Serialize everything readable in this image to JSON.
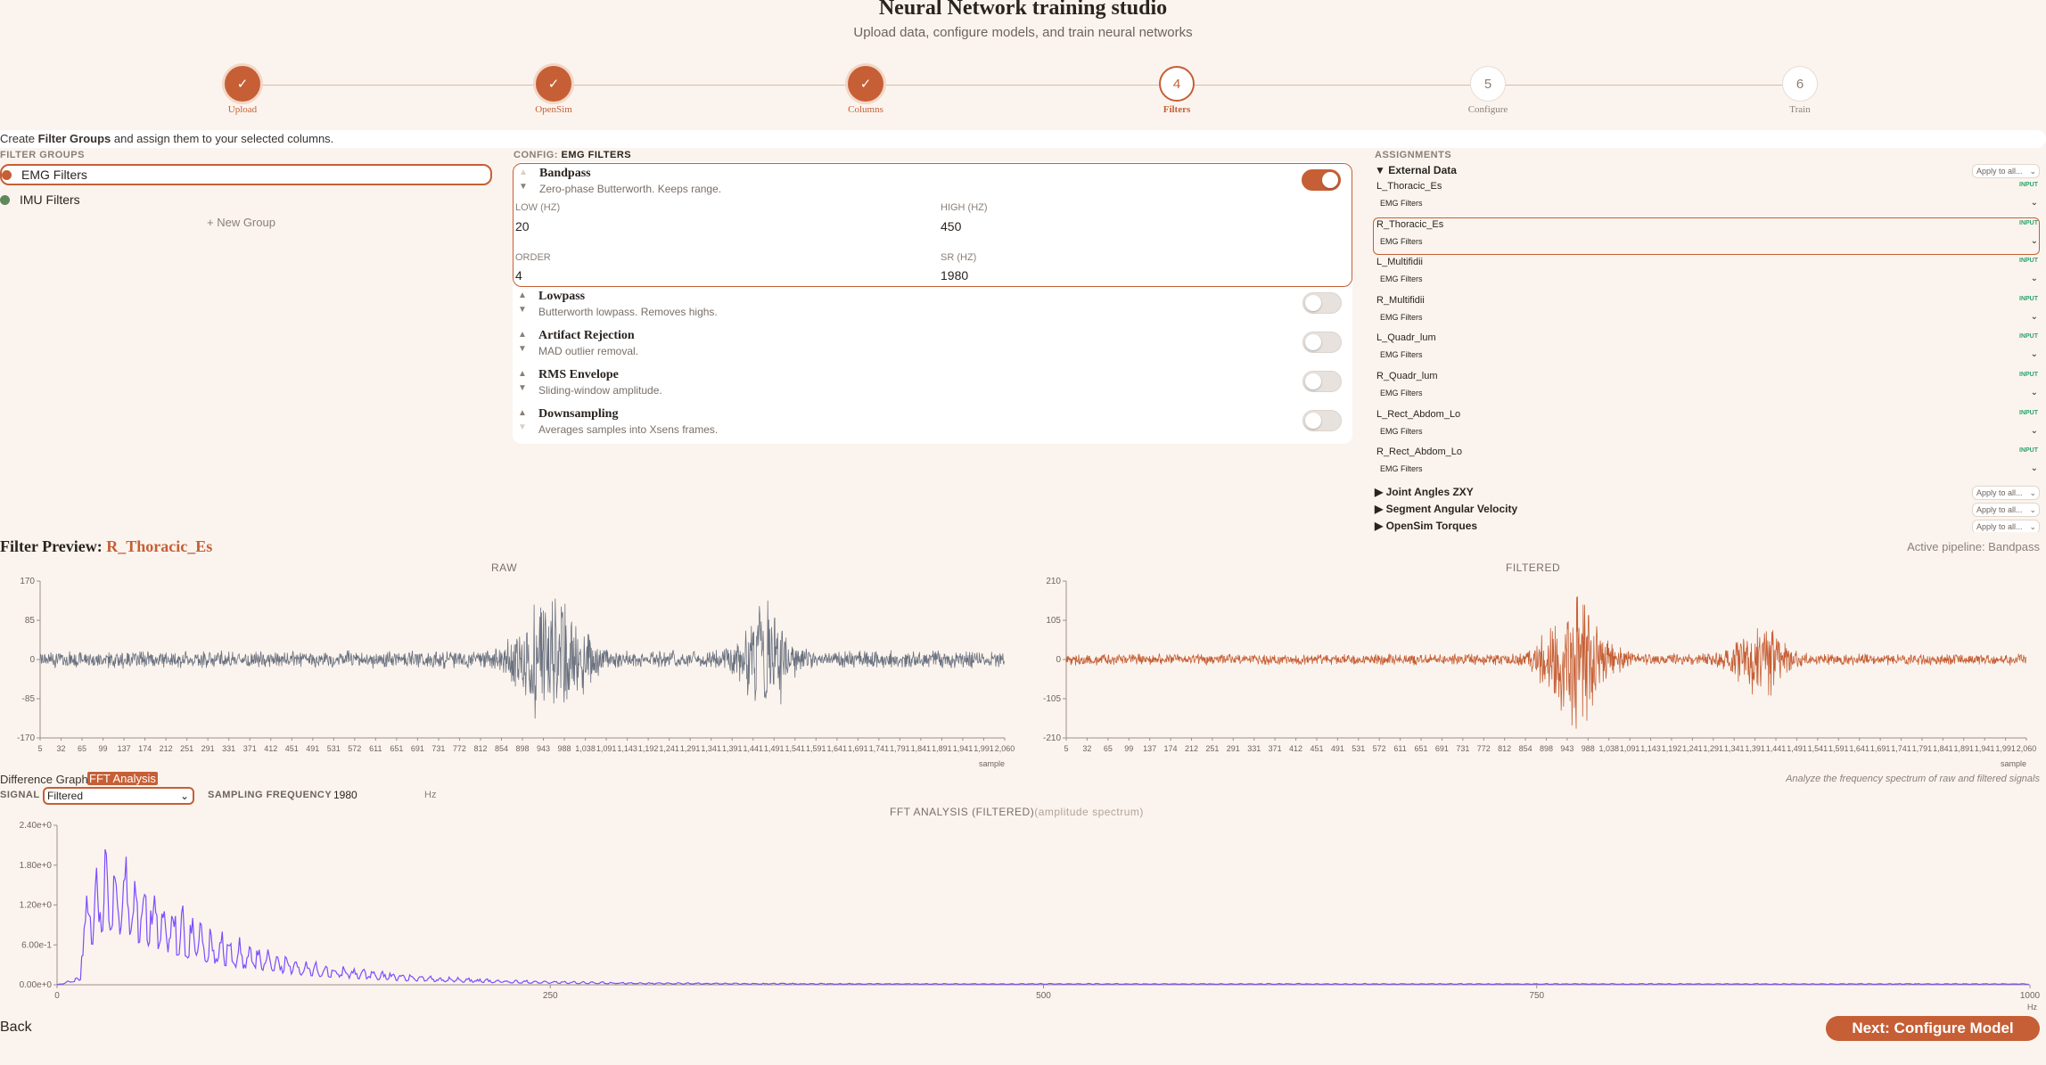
{
  "header": {
    "title": "Neural Network training studio",
    "subtitle": "Upload data, configure models, and train neural networks"
  },
  "stepper": [
    {
      "label": "Upload",
      "state": "done",
      "mark": "✓"
    },
    {
      "label": "OpenSim",
      "state": "done",
      "mark": "✓"
    },
    {
      "label": "Columns",
      "state": "done",
      "mark": "✓"
    },
    {
      "label": "Filters",
      "state": "active",
      "mark": "4"
    },
    {
      "label": "Configure",
      "state": "pending",
      "mark": "5"
    },
    {
      "label": "Train",
      "state": "pending",
      "mark": "6"
    }
  ],
  "instructions": {
    "pre": "Create ",
    "bold": "Filter Groups",
    "post": " and assign them to your selected columns."
  },
  "filter_groups": {
    "heading": "FILTER GROUPS",
    "items": [
      {
        "label": "EMG Filters",
        "color": "#c65f35",
        "selected": true
      },
      {
        "label": "IMU Filters",
        "color": "#5e8a5a",
        "selected": false
      }
    ],
    "new_group": "+ New Group"
  },
  "config": {
    "heading_prefix": "CONFIG: ",
    "heading_name": "EMG FILTERS",
    "filters": [
      {
        "name": "Bandpass",
        "desc": "Zero-phase Butterworth. Keeps range.",
        "enabled": true
      },
      {
        "name": "Lowpass",
        "desc": "Butterworth lowpass. Removes highs.",
        "enabled": false
      },
      {
        "name": "Artifact Rejection",
        "desc": "MAD outlier removal.",
        "enabled": false
      },
      {
        "name": "RMS Envelope",
        "desc": "Sliding-window amplitude.",
        "enabled": false
      },
      {
        "name": "Downsampling",
        "desc": "Averages samples into Xsens frames.",
        "enabled": false
      }
    ],
    "bandpass_params": {
      "low_label": "LOW (HZ)",
      "low_value": "20",
      "high_label": "HIGH (HZ)",
      "high_value": "450",
      "order_label": "ORDER",
      "order_value": "4",
      "sr_label": "SR (HZ)",
      "sr_value": "1980"
    }
  },
  "assignments": {
    "heading": "ASSIGNMENTS",
    "apply_label": "Apply to all...",
    "badge": "INPUT",
    "external_group": "External Data",
    "columns": [
      {
        "name": "L_Thoracic_Es",
        "filter": "EMG Filters"
      },
      {
        "name": "R_Thoracic_Es",
        "filter": "EMG Filters"
      },
      {
        "name": "L_Multifidii",
        "filter": "EMG Filters"
      },
      {
        "name": "R_Multifidii",
        "filter": "EMG Filters"
      },
      {
        "name": "L_Quadr_lum",
        "filter": "EMG Filters"
      },
      {
        "name": "R_Quadr_lum",
        "filter": "EMG Filters"
      },
      {
        "name": "L_Rect_Abdom_Lo",
        "filter": "EMG Filters"
      },
      {
        "name": "R_Rect_Abdom_Lo",
        "filter": "EMG Filters"
      }
    ],
    "collapsed_groups": [
      "Joint Angles ZXY",
      "Segment Angular Velocity",
      "OpenSim Torques"
    ]
  },
  "preview": {
    "title_prefix": "Filter Preview: ",
    "column": "R_Thoracic_Es",
    "active_pipeline": "Active pipeline: Bandpass"
  },
  "analysis": {
    "tab_diff": "Difference Graph",
    "tab_fft": "FFT Analysis",
    "note": "Analyze the frequency spectrum of raw and filtered signals",
    "signal_label": "SIGNAL",
    "signal_value": "Filtered",
    "sf_label": "SAMPLING FREQUENCY",
    "sf_value": "1980",
    "sf_unit": "Hz",
    "fft_title": "FFT ANALYSIS (FILTERED)",
    "fft_subtitle": "(amplitude spectrum)"
  },
  "footer": {
    "back": "Back",
    "next": "Next: Configure Model"
  },
  "chart_data": [
    {
      "type": "line",
      "title": "RAW",
      "xlabel": "sample",
      "color": "#6b7280",
      "ylim": [
        -170,
        170
      ],
      "yticks": [
        "170",
        "85",
        "0",
        "-85",
        "-170"
      ],
      "xticks": [
        "5",
        "32",
        "65",
        "99",
        "137",
        "174",
        "212",
        "251",
        "291",
        "331",
        "371",
        "412",
        "451",
        "491",
        "531",
        "572",
        "611",
        "651",
        "691",
        "731",
        "772",
        "812",
        "854",
        "898",
        "943",
        "988",
        "1,038",
        "1,091",
        "1,143",
        "1,192",
        "1,241",
        "1,291",
        "1,341",
        "1,391",
        "1,441",
        "1,491",
        "1,541",
        "1,591",
        "1,641",
        "1,691",
        "1,741",
        "1,791",
        "1,841",
        "1,891",
        "1,941",
        "1,991",
        "2,060"
      ],
      "baseline_amp": 15,
      "bursts": [
        {
          "center": 0.53,
          "width": 0.05,
          "amp": 160
        },
        {
          "center": 0.75,
          "width": 0.035,
          "amp": 140
        }
      ]
    },
    {
      "type": "line",
      "title": "FILTERED",
      "xlabel": "sample",
      "color": "#c65f35",
      "ylim": [
        -210,
        210
      ],
      "yticks": [
        "210",
        "105",
        "0",
        "-105",
        "-210"
      ],
      "xticks": [
        "5",
        "32",
        "65",
        "99",
        "137",
        "174",
        "212",
        "251",
        "291",
        "331",
        "371",
        "412",
        "451",
        "491",
        "531",
        "572",
        "611",
        "651",
        "691",
        "731",
        "772",
        "812",
        "854",
        "898",
        "943",
        "988",
        "1,038",
        "1,091",
        "1,143",
        "1,192",
        "1,241",
        "1,291",
        "1,341",
        "1,391",
        "1,441",
        "1,491",
        "1,541",
        "1,591",
        "1,641",
        "1,691",
        "1,741",
        "1,791",
        "1,841",
        "1,891",
        "1,941",
        "1,991",
        "2,060"
      ],
      "baseline_amp": 12,
      "bursts": [
        {
          "center": 0.53,
          "width": 0.045,
          "amp": 195
        },
        {
          "center": 0.72,
          "width": 0.04,
          "amp": 120
        }
      ]
    },
    {
      "type": "line",
      "title": "FFT ANALYSIS (FILTERED)",
      "color": "#7c4dff",
      "xlim": [
        0,
        1000
      ],
      "ylim": [
        0,
        2.4
      ],
      "xlabel": "Hz",
      "yticks": [
        "2.40e+0",
        "1.80e+0",
        "1.20e+0",
        "6.00e-1",
        "0.00e+0"
      ],
      "xticks": [
        "0",
        "250",
        "500",
        "750",
        "1000"
      ],
      "peak_hz": 25,
      "peak_value": 2.4
    }
  ]
}
